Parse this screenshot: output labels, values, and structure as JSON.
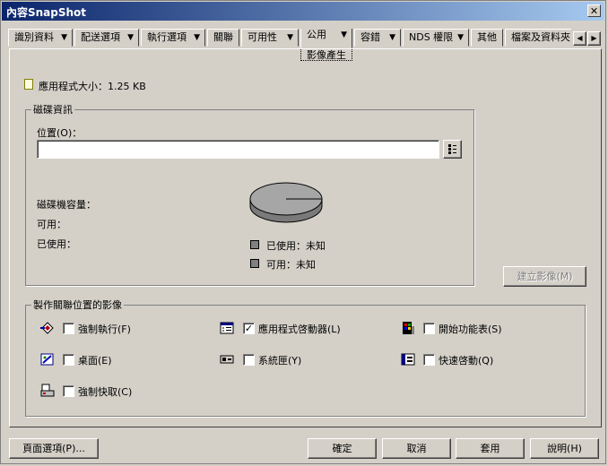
{
  "window": {
    "title": "內容SnapShot",
    "close_glyph": "✕"
  },
  "tabs": [
    {
      "label": "識別資料",
      "arrow": "▼"
    },
    {
      "label": "配送選項",
      "arrow": "▼"
    },
    {
      "label": "執行選項",
      "arrow": "▼"
    },
    {
      "label": "關聯",
      "arrow": ""
    },
    {
      "label": "可用性",
      "arrow": "▼"
    },
    {
      "label": "公用",
      "arrow": "▼"
    },
    {
      "label": "容錯",
      "arrow": "▼"
    },
    {
      "label": "NDS 權限",
      "arrow": "▼"
    },
    {
      "label": "其他",
      "arrow": ""
    },
    {
      "label": "檔案及資料夾",
      "arrow": ""
    }
  ],
  "active_subtab": "影像產生",
  "scroll_buttons": {
    "left": "◀",
    "right": "▶"
  },
  "app_size": {
    "label": "應用程式大小：1.25 KB"
  },
  "disk_info": {
    "legend": "磁碟資訊",
    "location_label": "位置(O)：",
    "location_value": "",
    "capacity_label": "磁碟機容量：",
    "available_label": "可用：",
    "used_label": "已使用：",
    "legend_used": "已使用：未知",
    "legend_available": "可用：未知",
    "create_image_button": "建立影像(M)"
  },
  "associations": {
    "legend": "製作關聯位置的影像",
    "items": [
      {
        "label": "強制執行(F)",
        "checked": false,
        "icon": "force-run-icon"
      },
      {
        "label": "應用程式啓動器(L)",
        "checked": true,
        "icon": "app-launcher-icon"
      },
      {
        "label": "開始功能表(S)",
        "checked": false,
        "icon": "start-menu-icon"
      },
      {
        "label": "桌面(E)",
        "checked": false,
        "icon": "desktop-icon"
      },
      {
        "label": "系統匣(Y)",
        "checked": false,
        "icon": "system-tray-icon"
      },
      {
        "label": "快速啓動(Q)",
        "checked": false,
        "icon": "quick-launch-icon"
      },
      {
        "label": "強制快取(C)",
        "checked": false,
        "icon": "force-cache-icon"
      }
    ]
  },
  "footer": {
    "page_options": "頁面選項(P)...",
    "ok": "確定",
    "cancel": "取消",
    "apply": "套用",
    "help": "說明(H)"
  }
}
